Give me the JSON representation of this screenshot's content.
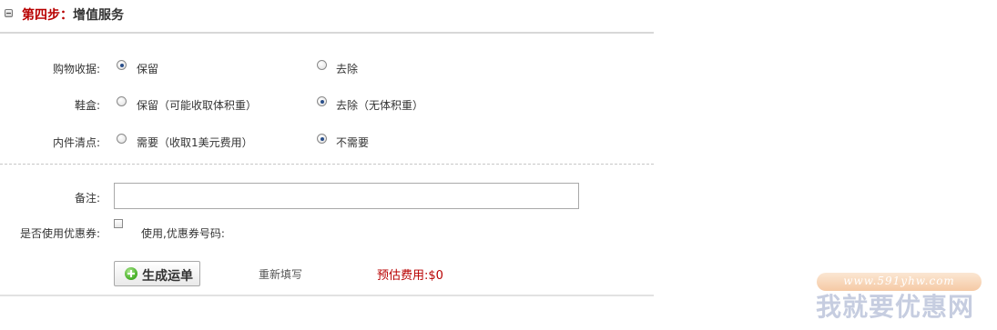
{
  "section": {
    "step_label": "第四步：",
    "title": "增值服务"
  },
  "options": [
    {
      "label": "购物收据:",
      "choice_a": "保留",
      "choice_b": "去除",
      "selected": "a"
    },
    {
      "label": "鞋盒:",
      "choice_a": "保留（可能收取体积重）",
      "choice_b": "去除（无体积重）",
      "selected": "b"
    },
    {
      "label": "内件清点:",
      "choice_a": "需要（收取1美元费用）",
      "choice_b": "不需要",
      "selected": "b"
    }
  ],
  "remark": {
    "label": "备注:",
    "value": ""
  },
  "coupon": {
    "label": "是否使用优惠券:",
    "checkbox_text": "使用,优惠券号码:",
    "checked": false
  },
  "actions": {
    "generate_label": "生成运单",
    "reset_label": "重新填写",
    "fee_label": "预估费用:",
    "fee_value": "$0"
  },
  "watermark": {
    "url": "www.591yhw.com",
    "name": "我就要优惠网"
  }
}
